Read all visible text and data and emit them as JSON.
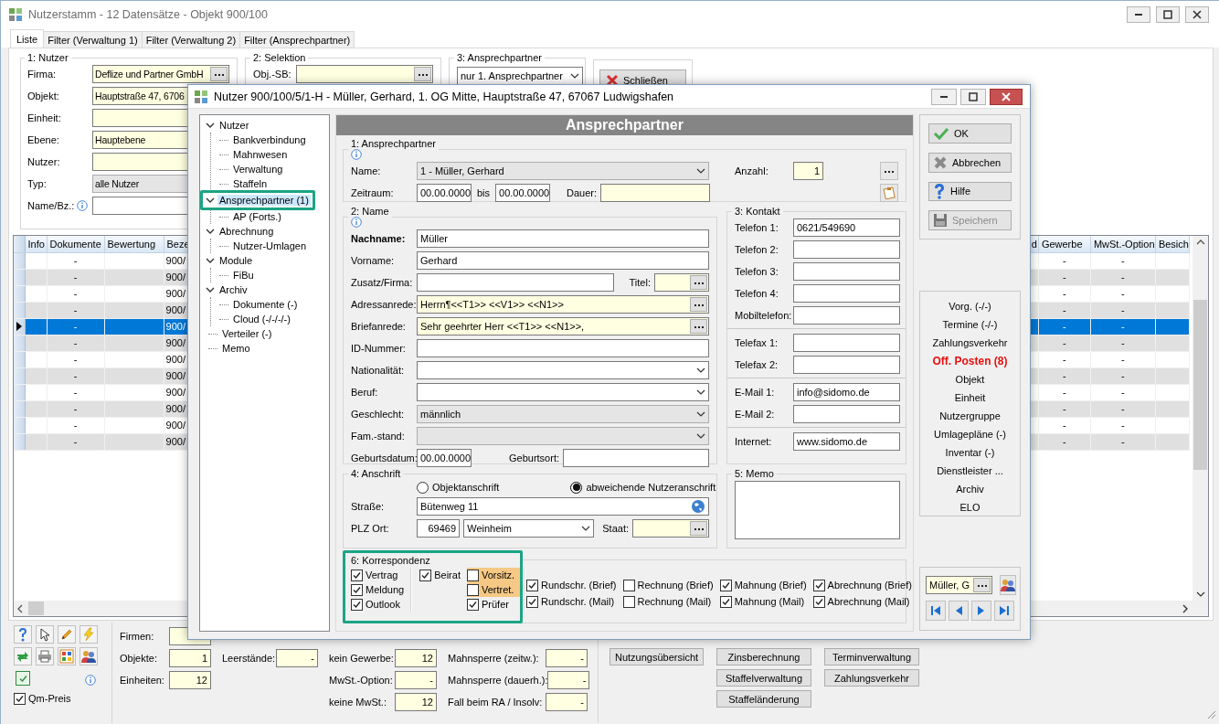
{
  "main_window": {
    "title": "Nutzerstamm - 12 Datensätze - Objekt 900/100",
    "tabs": [
      {
        "label": "Liste",
        "selected": true
      },
      {
        "label": "Filter (Verwaltung 1)",
        "selected": false
      },
      {
        "label": "Filter (Verwaltung 2)",
        "selected": false
      },
      {
        "label": "Filter (Ansprechpartner)",
        "selected": false
      }
    ],
    "nutzer_group": {
      "legend": "1: Nutzer",
      "fields": [
        {
          "label": "Firma:",
          "value": "Deflize und Partner GmbH",
          "kind": "lookup"
        },
        {
          "label": "Objekt:",
          "value": "Hauptstraße 47, 6706",
          "kind": "readonly"
        },
        {
          "label": "Einheit:",
          "kind": "readonly"
        },
        {
          "label": "Ebene:",
          "value": "Hauptebene",
          "kind": "readonly"
        },
        {
          "label": "Nutzer:",
          "kind": "readonly"
        },
        {
          "label": "Typ:",
          "value": "alle Nutzer",
          "kind": "dropdown"
        },
        {
          "label": "Name/Bz.:",
          "kind": "search",
          "info": true
        }
      ]
    },
    "selektion_group": {
      "legend": "2: Selektion",
      "fields": [
        {
          "label": "Obj.-SB:",
          "kind": "lookup"
        }
      ]
    },
    "ansprechpartner_group": {
      "legend": "3: Ansprechpartner",
      "value": "nur 1. Ansprechpartner"
    },
    "close_button": "Schließen",
    "table": {
      "columns": [
        "Info",
        "Dokumente",
        "Bewertung",
        "Beze",
        "d",
        "Gewerbe",
        "MwSt.-Option",
        "Besich"
      ],
      "rows": [
        {
          "dokumente": "-",
          "beze": "900/",
          "gewerbe": "-",
          "mwst_option": "-",
          "selected": false
        },
        {
          "dokumente": "-",
          "beze": "900/",
          "gewerbe": "-",
          "mwst_option": "-",
          "selected": false
        },
        {
          "dokumente": "-",
          "beze": "900/",
          "gewerbe": "-",
          "mwst_option": "-",
          "selected": false
        },
        {
          "dokumente": "-",
          "beze": "900/",
          "gewerbe": "-",
          "mwst_option": "-",
          "selected": false
        },
        {
          "dokumente": "-",
          "beze": "900/",
          "gewerbe": "-",
          "mwst_option": "-",
          "selected": true
        },
        {
          "dokumente": "-",
          "beze": "900/",
          "gewerbe": "-",
          "mwst_option": "-",
          "selected": false
        },
        {
          "dokumente": "-",
          "beze": "900/",
          "gewerbe": "-",
          "mwst_option": "-",
          "selected": false
        },
        {
          "dokumente": "-",
          "beze": "900/",
          "gewerbe": "-",
          "mwst_option": "-",
          "selected": false
        },
        {
          "dokumente": "-",
          "beze": "900/",
          "gewerbe": "-",
          "mwst_option": "-",
          "selected": false
        },
        {
          "dokumente": "-",
          "beze": "900/",
          "gewerbe": "-",
          "mwst_option": "-",
          "selected": false
        },
        {
          "dokumente": "-",
          "beze": "900/",
          "gewerbe": "-",
          "mwst_option": "-",
          "selected": false
        },
        {
          "dokumente": "-",
          "beze": "900/",
          "gewerbe": "-",
          "mwst_option": "-",
          "selected": false
        }
      ]
    },
    "footer": {
      "grid_checkbox": {
        "checked": true
      },
      "qm_preis": {
        "label": "Qm-Preis",
        "checked": true
      },
      "stat_columns": [
        [
          {
            "label": "Firmen:"
          },
          {
            "label": "Objekte:",
            "value": "1"
          },
          {
            "label": "Einheiten:",
            "value": "12"
          }
        ],
        [
          {
            "label": "Leerstände:",
            "value": "-"
          }
        ],
        [
          {
            "label": "kein Gewerbe:",
            "value": "12"
          },
          {
            "label": "MwSt.-Option:",
            "value": "-"
          },
          {
            "label": "keine MwSt.:",
            "value": "12"
          }
        ],
        [
          {
            "label": "Mahnsperre (zeitw.):",
            "value": "-"
          },
          {
            "label": "Mahnsperre (dauerh.):",
            "value": "-"
          },
          {
            "label": "Fall beim RA / Insolv:",
            "value": "-"
          }
        ]
      ],
      "button_columns": [
        [
          "Nutzungsübersicht"
        ],
        [
          "Zinsberechnung",
          "Staffelverwaltung",
          "Staffeländerung"
        ],
        [
          "Terminverwaltung",
          "Zahlungsverkehr"
        ]
      ]
    }
  },
  "dialog": {
    "title": "Nutzer 900/100/5/1-H - Müller, Gerhard, 1. OG Mitte, Hauptstraße 47, 67067 Ludwigshafen",
    "tree": [
      {
        "label": "Nutzer",
        "expanded": true,
        "selected": false,
        "highlighted": false,
        "children": [
          {
            "label": "Bankverbindung",
            "selected": false
          },
          {
            "label": "Mahnwesen",
            "selected": false
          },
          {
            "label": "Verwaltung",
            "selected": false
          },
          {
            "label": "Staffeln",
            "selected": false
          }
        ]
      },
      {
        "label": "Ansprechpartner (1)",
        "expanded": true,
        "selected": true,
        "highlighted": true,
        "children": [
          {
            "label": "AP (Forts.)",
            "selected": false
          }
        ]
      },
      {
        "label": "Abrechnung",
        "expanded": true,
        "selected": false,
        "highlighted": false,
        "children": [
          {
            "label": "Nutzer-Umlagen",
            "selected": false
          }
        ]
      },
      {
        "label": "Module",
        "expanded": true,
        "selected": false,
        "highlighted": false,
        "children": [
          {
            "label": "FiBu",
            "selected": false
          }
        ]
      },
      {
        "label": "Archiv",
        "expanded": true,
        "selected": false,
        "highlighted": false,
        "children": [
          {
            "label": "Dokumente (-)",
            "selected": false
          },
          {
            "label": "Cloud (-/-/-/-)",
            "selected": false
          }
        ]
      },
      {
        "label": "Verteiler (-)",
        "selected": false,
        "highlighted": false
      },
      {
        "label": "Memo",
        "selected": false,
        "highlighted": false
      }
    ],
    "header": "Ansprechpartner",
    "ansprechpartner": {
      "legend": "1: Ansprechpartner",
      "name_label": "Name:",
      "name": "1 - Müller, Gerhard",
      "anzahl_label": "Anzahl:",
      "anzahl": "1",
      "zeitraum_label": "Zeitraum:",
      "from": "00.00.0000",
      "bis_label": "bis",
      "to": "00.00.0000",
      "dauer_label": "Dauer:"
    },
    "name_group": {
      "legend": "2: Name",
      "fields": [
        {
          "label": "Nachname:",
          "value": "Müller",
          "kind": "text",
          "bold": true
        },
        {
          "label": "Vorname:",
          "value": "Gerhard",
          "kind": "text",
          "bold": false
        },
        {
          "label": "Zusatz/Firma:",
          "kind": "short",
          "bold": false,
          "extra": {
            "label": "Titel:",
            "kind": "lookup"
          }
        },
        {
          "label": "Adressanrede:",
          "value": "Herrn¶<<T1>> <<V1>> <<N1>>",
          "kind": "lookup",
          "bold": false
        },
        {
          "label": "Briefanrede:",
          "value": "Sehr geehrter Herr <<T1>> <<N1>>,",
          "kind": "lookup",
          "bold": false
        },
        {
          "label": "ID-Nummer:",
          "kind": "text",
          "bold": false
        },
        {
          "label": "Nationalität:",
          "kind": "combo",
          "bold": false
        },
        {
          "label": "Beruf:",
          "kind": "combo",
          "bold": false
        },
        {
          "label": "Geschlecht:",
          "value": "männlich",
          "kind": "dropdown",
          "bold": false
        },
        {
          "label": "Fam.-stand:",
          "kind": "dropdown",
          "bold": false
        },
        {
          "label": "Geburtsdatum:",
          "value": "00.00.0000",
          "kind": "date",
          "bold": false,
          "extra": {
            "label": "Geburtsort:",
            "kind": "text"
          }
        }
      ]
    },
    "kontakt": {
      "legend": "3: Kontakt",
      "sections": [
        [
          {
            "label": "Telefon 1:",
            "value": "0621/549690"
          },
          {
            "label": "Telefon 2:"
          },
          {
            "label": "Telefon 3:"
          },
          {
            "label": "Telefon 4:"
          },
          {
            "label": "Mobiltelefon:"
          }
        ],
        [
          {
            "label": "Telefax 1:"
          },
          {
            "label": "Telefax 2:"
          }
        ],
        [
          {
            "label": "E-Mail 1:",
            "value": "info@sidomo.de"
          },
          {
            "label": "E-Mail 2:"
          }
        ],
        [
          {
            "label": "Internet:",
            "value": "www.sidomo.de"
          }
        ]
      ]
    },
    "anschrift": {
      "legend": "4: Anschrift",
      "radios": [
        {
          "label": "Objektanschrift",
          "selected": false
        },
        {
          "label": "abweichende Nutzeranschrift",
          "selected": true
        }
      ],
      "strasse_label": "Straße:",
      "strasse": "Bütenweg 11",
      "plz_label": "PLZ Ort:",
      "plz": "69469",
      "ort": "Weinheim",
      "staat_label": "Staat:"
    },
    "memo": {
      "legend": "5: Memo"
    },
    "korrespondenz": {
      "legend": "6: Korrespondenz",
      "highlighted": true,
      "columns": [
        [
          {
            "label": "Vertrag",
            "checked": true
          },
          {
            "label": "Meldung",
            "checked": true
          },
          {
            "label": "Outlook",
            "checked": true
          }
        ],
        [
          {
            "label": "Beirat",
            "checked": true
          }
        ],
        [
          {
            "label": "Vorsitz.",
            "checked": false,
            "highlighted": true
          },
          {
            "label": "Vertret.",
            "checked": false,
            "highlighted": true
          },
          {
            "label": "Prüfer",
            "checked": true,
            "highlighted": false
          }
        ],
        [
          {
            "label": "Rundschr. (Brief)",
            "checked": true
          },
          {
            "label": "Rundschr. (Mail)",
            "checked": true
          }
        ],
        [
          {
            "label": "Rechnung (Brief)",
            "checked": false
          },
          {
            "label": "Rechnung (Mail)",
            "checked": false
          }
        ],
        [
          {
            "label": "Mahnung (Brief)",
            "checked": true
          },
          {
            "label": "Mahnung (Mail)",
            "checked": true
          }
        ],
        [
          {
            "label": "Abrechnung (Brief)",
            "checked": true
          },
          {
            "label": "Abrechnung (Mail)",
            "checked": true
          }
        ]
      ]
    },
    "buttons": [
      {
        "label": "OK",
        "kind": "ok",
        "disabled": false
      },
      {
        "label": "Abbrechen",
        "kind": "cancel",
        "disabled": false
      },
      {
        "label": "Hilfe",
        "kind": "help",
        "disabled": false
      },
      {
        "label": "Speichern",
        "kind": "save",
        "disabled": true
      }
    ],
    "links": [
      {
        "label": "Vorg. (-/-)",
        "alert": false
      },
      {
        "label": "Termine (-/-)",
        "alert": false
      },
      {
        "label": "Zahlungsverkehr",
        "alert": false
      },
      {
        "label": "Off. Posten (8)",
        "alert": true
      },
      {
        "label": "Objekt",
        "alert": false
      },
      {
        "label": "Einheit",
        "alert": false
      },
      {
        "label": "Nutzergruppe",
        "alert": false
      },
      {
        "label": "Umlagepläne (-)",
        "alert": false
      },
      {
        "label": "Inventar (-)",
        "alert": false
      },
      {
        "label": "Dienstleister ...",
        "alert": false
      },
      {
        "label": "Archiv",
        "alert": false
      },
      {
        "label": "ELO",
        "alert": false
      }
    ],
    "navigator": {
      "value": "Müller, G"
    }
  }
}
